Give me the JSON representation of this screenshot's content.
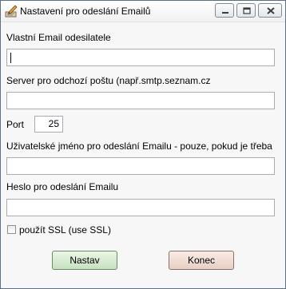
{
  "window": {
    "title": "Nastavení pro odeslání Emailů",
    "controls": [
      "minimize",
      "maximize",
      "close"
    ]
  },
  "form": {
    "sender_email_label": "Vlastní Email odesilatele",
    "sender_email_value": "",
    "smtp_server_label": "Server pro odchozí poštu (např.smtp.seznam.cz",
    "smtp_server_value": "",
    "port_label": "Port",
    "port_value": "25",
    "username_label": "Uživatelské jméno pro odeslání Emailu - pouze, pokud je třeba",
    "username_value": "",
    "password_label": "Heslo pro odeslání Emailu",
    "password_value": "",
    "ssl_label": "použít SSL (use SSL)",
    "ssl_checked": false
  },
  "buttons": {
    "ok_label": "Nastav",
    "cancel_label": "Konec"
  },
  "colors": {
    "ok_button": "#c7e2c0",
    "cancel_button": "#e8cfc3"
  },
  "icons": {
    "app": "edit-pencil-icon",
    "minimize": "minimize-icon",
    "maximize": "maximize-icon",
    "close": "close-icon"
  }
}
